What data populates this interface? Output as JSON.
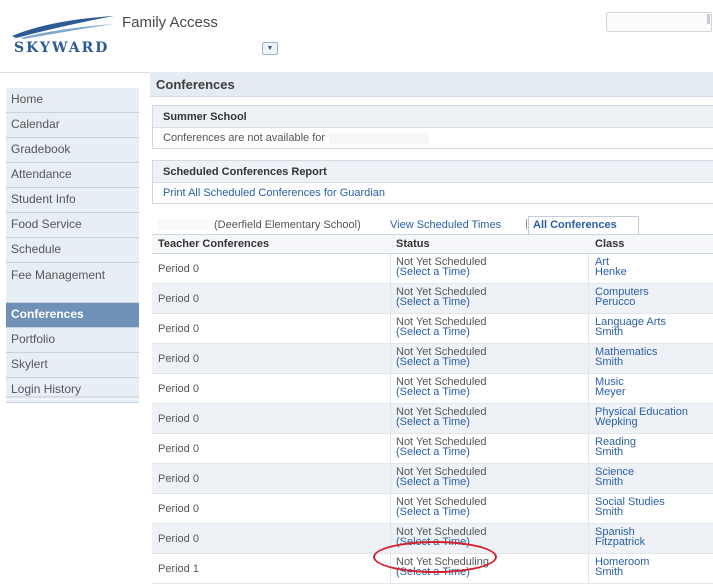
{
  "header": {
    "logo_text": "SKYWARD",
    "app_title": "Family Access",
    "student_select_icon": "chevron-down-icon"
  },
  "sidebar": {
    "items": [
      {
        "label": "Home"
      },
      {
        "label": "Calendar"
      },
      {
        "label": "Gradebook"
      },
      {
        "label": "Attendance"
      },
      {
        "label": "Student Info"
      },
      {
        "label": "Food Service"
      },
      {
        "label": "Schedule"
      },
      {
        "label": "Fee Management"
      },
      {
        "label": "Conferences",
        "active": true
      },
      {
        "label": "Portfolio"
      },
      {
        "label": "Skylert"
      },
      {
        "label": "Login History"
      }
    ]
  },
  "page": {
    "title": "Conferences"
  },
  "summer_school": {
    "title": "Summer School",
    "message": "Conferences are not available for"
  },
  "report": {
    "title": "Scheduled Conferences Report",
    "print_link": "Print All Scheduled Conferences for Guardian"
  },
  "filter": {
    "school": "(Deerfield Elementary School)",
    "view_link": "View Scheduled Times",
    "separator": "|",
    "all_link": "All Conferences"
  },
  "grid": {
    "headers": {
      "teacher": "Teacher Conferences",
      "status": "Status",
      "class": "Class"
    },
    "rows": [
      {
        "period": "Period 0",
        "status": "Not Yet Scheduled",
        "action": "(Select a Time)",
        "course": "Art",
        "teacher": "Henke"
      },
      {
        "period": "Period 0",
        "status": "Not Yet Scheduled",
        "action": "(Select a Time)",
        "course": "Computers",
        "teacher": "Perucco"
      },
      {
        "period": "Period 0",
        "status": "Not Yet Scheduled",
        "action": "(Select a Time)",
        "course": "Language Arts",
        "teacher": "Smith"
      },
      {
        "period": "Period 0",
        "status": "Not Yet Scheduled",
        "action": "(Select a Time)",
        "course": "Mathematics",
        "teacher": "Smith"
      },
      {
        "period": "Period 0",
        "status": "Not Yet Scheduled",
        "action": "(Select a Time)",
        "course": "Music",
        "teacher": "Meyer"
      },
      {
        "period": "Period 0",
        "status": "Not Yet Scheduled",
        "action": "(Select a Time)",
        "course": "Physical Education",
        "teacher": "Wepking"
      },
      {
        "period": "Period 0",
        "status": "Not Yet Scheduled",
        "action": "(Select a Time)",
        "course": "Reading",
        "teacher": "Smith"
      },
      {
        "period": "Period 0",
        "status": "Not Yet Scheduled",
        "action": "(Select a Time)",
        "course": "Science",
        "teacher": "Smith"
      },
      {
        "period": "Period 0",
        "status": "Not Yet Scheduled",
        "action": "(Select a Time)",
        "course": "Social Studies",
        "teacher": "Smith"
      },
      {
        "period": "Period 0",
        "status": "Not Yet Scheduled",
        "action": "(Select a Time)",
        "course": "Spanish",
        "teacher": "Fitzpatrick"
      },
      {
        "period": "Period 1",
        "status": "Not Yet Scheduling",
        "action": "(Select a Time)",
        "course": "Homeroom",
        "teacher": "Smith"
      }
    ]
  },
  "colors": {
    "nav_active": "#6f90b7",
    "nav_bg": "#e8eef6",
    "link": "#2a5fa7",
    "highlight": "#d4202a"
  }
}
